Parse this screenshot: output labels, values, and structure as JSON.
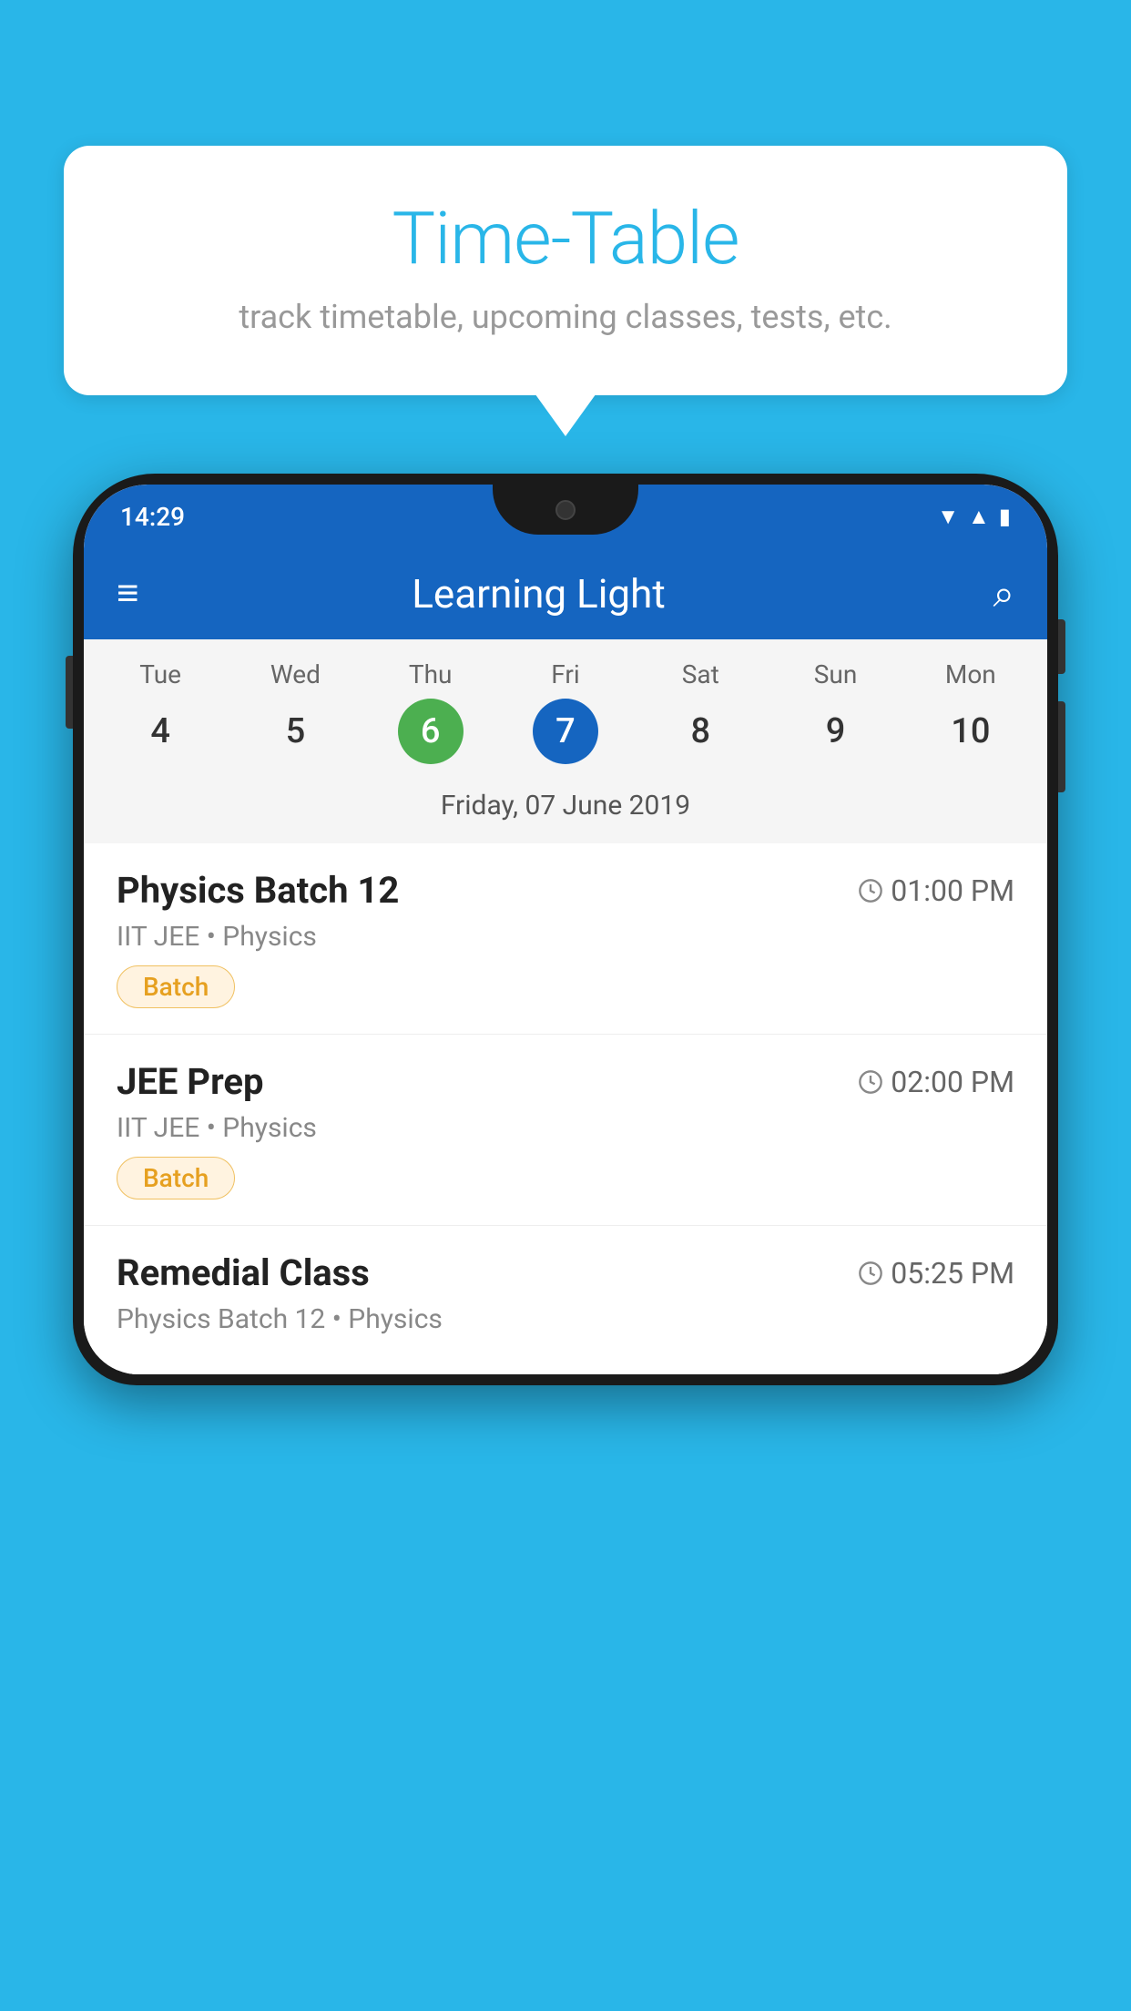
{
  "background_color": "#29b6e8",
  "tooltip": {
    "title": "Time-Table",
    "subtitle": "track timetable, upcoming classes, tests, etc."
  },
  "phone": {
    "status_bar": {
      "time": "14:29"
    },
    "app_bar": {
      "title": "Learning Light",
      "menu_label": "☰",
      "search_label": "🔍"
    },
    "calendar": {
      "days": [
        {
          "name": "Tue",
          "num": "4",
          "state": "normal"
        },
        {
          "name": "Wed",
          "num": "5",
          "state": "normal"
        },
        {
          "name": "Thu",
          "num": "6",
          "state": "today"
        },
        {
          "name": "Fri",
          "num": "7",
          "state": "selected"
        },
        {
          "name": "Sat",
          "num": "8",
          "state": "normal"
        },
        {
          "name": "Sun",
          "num": "9",
          "state": "normal"
        },
        {
          "name": "Mon",
          "num": "10",
          "state": "normal"
        }
      ],
      "selected_date_label": "Friday, 07 June 2019"
    },
    "schedule": [
      {
        "title": "Physics Batch 12",
        "time": "01:00 PM",
        "subtitle": "IIT JEE • Physics",
        "badge": "Batch"
      },
      {
        "title": "JEE Prep",
        "time": "02:00 PM",
        "subtitle": "IIT JEE • Physics",
        "badge": "Batch"
      },
      {
        "title": "Remedial Class",
        "time": "05:25 PM",
        "subtitle": "Physics Batch 12 • Physics",
        "badge": null
      }
    ]
  }
}
